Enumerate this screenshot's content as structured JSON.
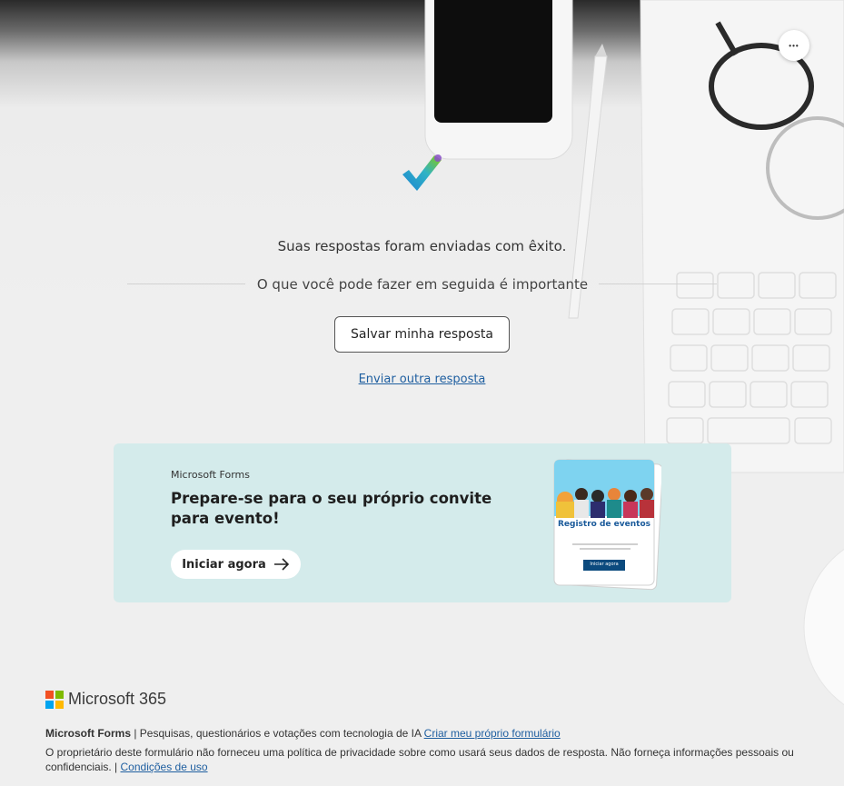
{
  "header": {
    "more_options_label": "•••"
  },
  "confirmation": {
    "success_message": "Suas respostas foram enviadas com êxito.",
    "next_steps_heading": "O que você pode fazer em seguida é importante",
    "save_button_label": "Salvar minha resposta",
    "send_another_label": "Enviar outra resposta"
  },
  "promo": {
    "brand": "Microsoft Forms",
    "title": "Prepare-se para o seu próprio convite para evento!",
    "start_button_label": "Iniciar agora",
    "card_title": "Registro de eventos",
    "card_button_label": "Iniciar agora"
  },
  "footer": {
    "brand_name": "Microsoft 365",
    "product_name": "Microsoft Forms",
    "product_tagline": " | Pesquisas, questionários e votações com tecnologia de IA ",
    "create_form_link": "Criar meu próprio formulário",
    "privacy_notice": "O proprietário deste formulário não forneceu uma política de privacidade sobre como usará seus dados de resposta. Não forneça informações pessoais ou confidenciais. | ",
    "terms_link": "Condições de uso"
  },
  "colors": {
    "link": "#1f5fa0",
    "promo_background": "#d4ebeb",
    "ms_red": "#f25022",
    "ms_green": "#7fba00",
    "ms_blue": "#00a4ef",
    "ms_yellow": "#ffb900"
  },
  "icons": [
    "more-options-icon",
    "checkmark-icon",
    "arrow-right-icon",
    "microsoft-logo-icon"
  ]
}
